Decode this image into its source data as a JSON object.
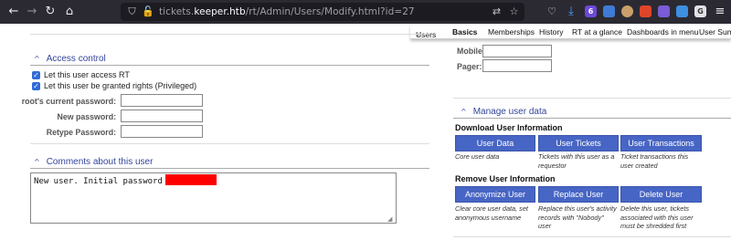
{
  "browser": {
    "url_prefix": "tickets.",
    "url_host": "keeper.htb",
    "url_path": "/rt/Admin/Users/Modify.html?id=27",
    "extension_badge": "6"
  },
  "tabs": {
    "users": "Users",
    "basics": "Basics",
    "memberships": "Memberships",
    "history": "History",
    "rt_at_a_glance": "RT at a glance",
    "dashboards": "Dashboards in menu",
    "user_summary": "User Summ"
  },
  "contact": {
    "mobile_label": "Mobile:",
    "pager_label": "Pager:"
  },
  "access_control": {
    "title": "Access control",
    "access_rt_label": "Let this user access RT",
    "access_rt_checked": true,
    "privileged_label": "Let this user be granted rights (Privileged)",
    "privileged_checked": true,
    "current_password_label": "root's current password:",
    "new_password_label": "New password:",
    "retype_password_label": "Retype Password:"
  },
  "comments": {
    "title": "Comments about this user",
    "text": "New user. Initial password set to"
  },
  "manage": {
    "title": "Manage user data",
    "download_heading": "Download User Information",
    "remove_heading": "Remove User Information",
    "download_buttons": [
      {
        "label": "User Data",
        "desc": "Core user data"
      },
      {
        "label": "User Tickets",
        "desc": "Tickets with this user as a requestor"
      },
      {
        "label": "User Transactions",
        "desc": "Ticket transactions this user created"
      }
    ],
    "remove_buttons": [
      {
        "label": "Anonymize User",
        "desc": "Clear core user data, set anonymous username"
      },
      {
        "label": "Replace User",
        "desc": "Replace this user's activity records with \"Nobody\" user"
      },
      {
        "label": "Delete User",
        "desc": "Delete this user, tickets associated with this user must be shredded first"
      }
    ]
  }
}
